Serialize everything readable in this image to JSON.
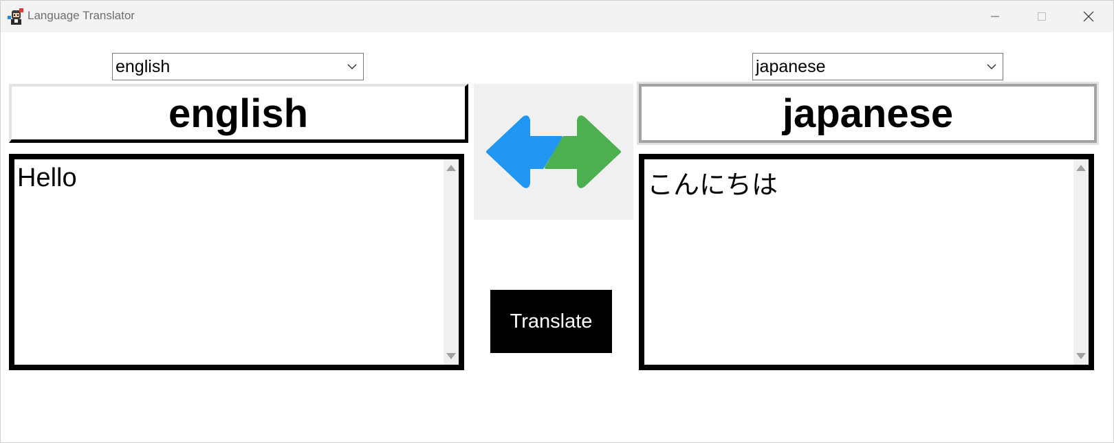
{
  "window": {
    "title": "Language Translator",
    "controls": {
      "minimize": "minimize-icon",
      "maximize": "maximize-icon",
      "close": "close-icon"
    }
  },
  "source": {
    "selected_language": "english",
    "header": "english",
    "text": "Hello"
  },
  "target": {
    "selected_language": "japanese",
    "header": "japanese",
    "text": "こんにちは"
  },
  "swap": {
    "icon": "swap-arrows-icon",
    "colors": {
      "left_arrow": "#2196f3",
      "right_arrow": "#4caf50"
    }
  },
  "actions": {
    "translate_label": "Translate"
  }
}
